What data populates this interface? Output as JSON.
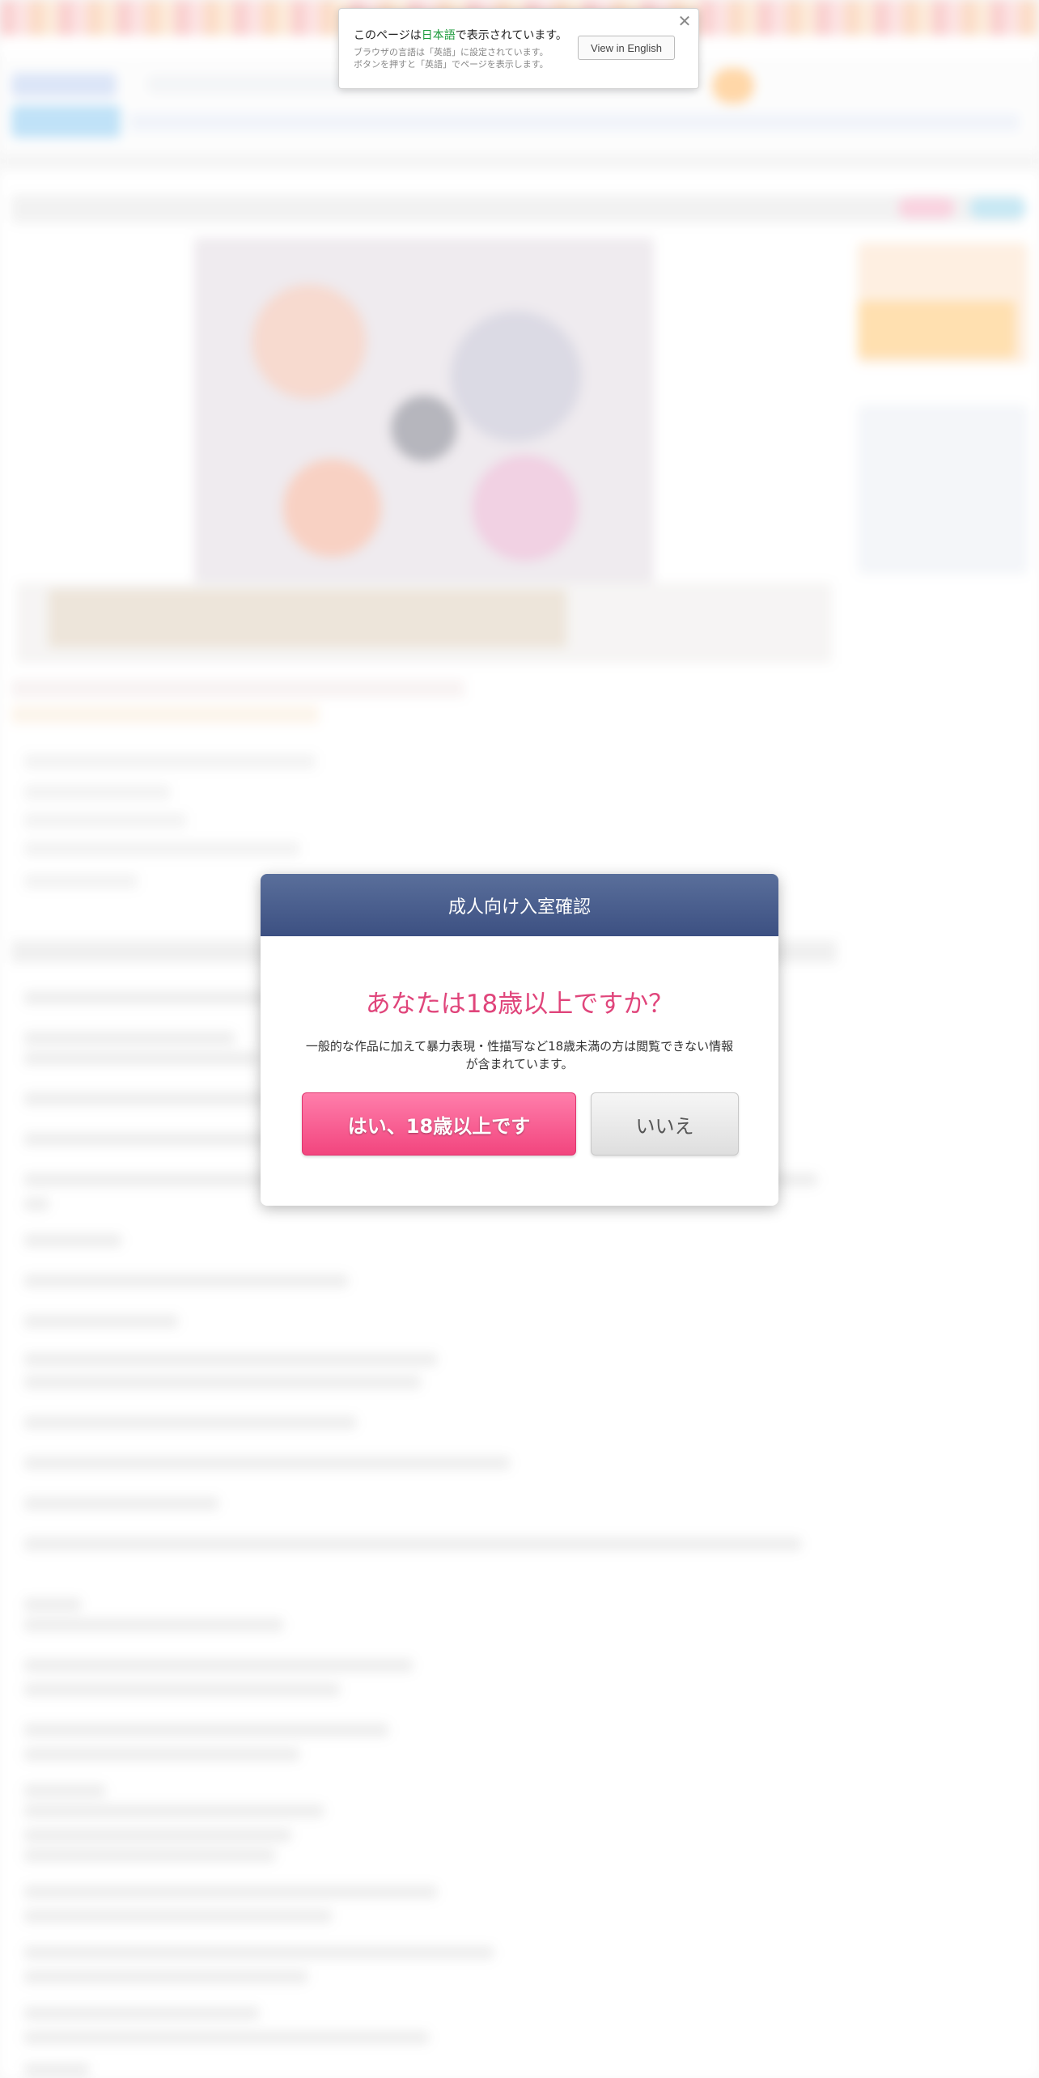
{
  "language_notice": {
    "title_prefix": "このページは",
    "title_language": "日本語",
    "title_suffix": "で表示されています。",
    "subtitle_line1": "ブラウザの言語は「英語」に設定されています。",
    "subtitle_line2": "ボタンを押すと「英語」でページを表示します。",
    "button_label": "View in English",
    "close_icon": "close-icon",
    "highlight_color": "#1a9a3a"
  },
  "age_modal": {
    "header": "成人向け入室確認",
    "question": "あなたは18歳以上ですか？",
    "description": "一般的な作品に加えて暴力表現・性描写など18歳未満の方は閲覧できない情報が含まれています。",
    "yes_label": "はい、18歳以上です",
    "no_label": "いいえ",
    "header_color": "#45598a",
    "question_color": "#e0457b",
    "yes_color": "#f2457e"
  }
}
